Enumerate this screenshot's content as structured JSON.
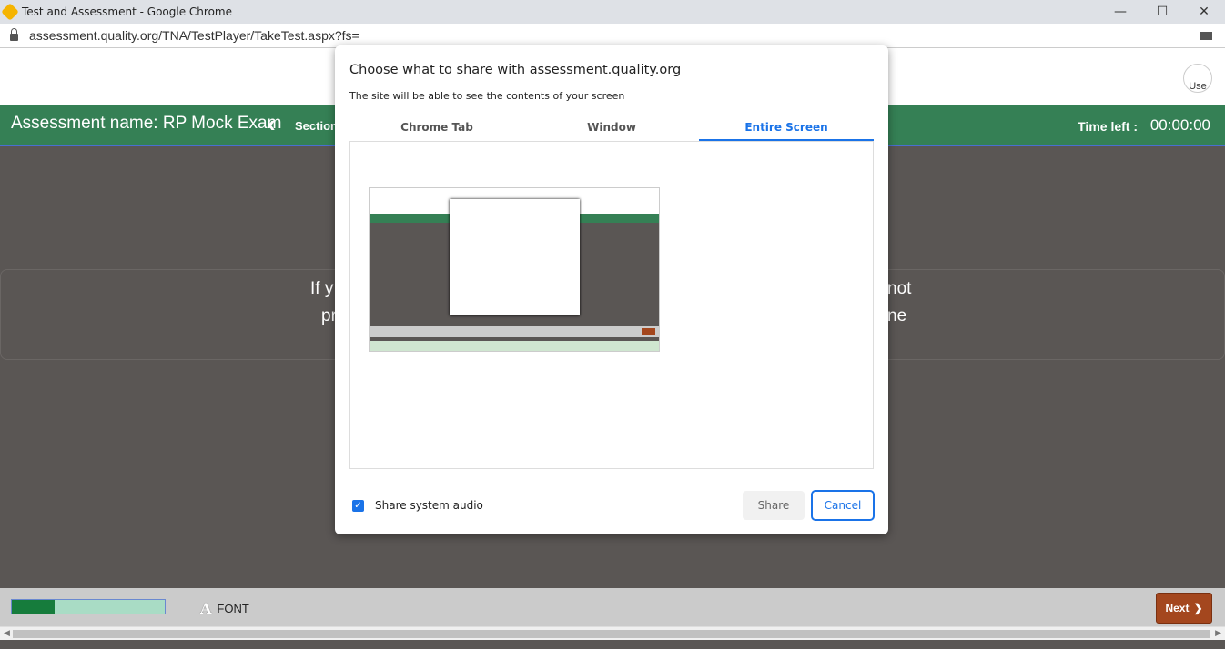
{
  "window": {
    "title": "Test and Assessment - Google Chrome",
    "minimize": "—",
    "maximize": "☐",
    "close": "✕"
  },
  "address_bar": {
    "url": "assessment.quality.org/TNA/TestPlayer/TakeTest.aspx?fs="
  },
  "header": {
    "avatar_alt": "Use",
    "assessment_name": "Assessment name: RP Mock Exam",
    "prev_icon": "‹",
    "section_label": "Section",
    "time_left_label": "Time left :",
    "time_left_value": "00:00:00"
  },
  "question": {
    "line1_left": "If y",
    "line1_right": "not",
    "line2_left": "pr",
    "line2_right": "ne"
  },
  "footer": {
    "progress_percent": 28,
    "font_icon": "A",
    "font_label": "FONT",
    "next_label": "Next",
    "next_icon": "❯"
  },
  "share_dialog": {
    "title": "Choose what to share with assessment.quality.org",
    "subtitle": "The site will be able to see the contents of your screen",
    "tabs": [
      {
        "label": "Chrome Tab",
        "active": false
      },
      {
        "label": "Window",
        "active": false
      },
      {
        "label": "Entire Screen",
        "active": true
      }
    ],
    "share_audio_label": "Share system audio",
    "share_audio_checked": true,
    "share_label": "Share",
    "cancel_label": "Cancel"
  },
  "colors": {
    "green": "#358055",
    "accent": "#1a73e8",
    "next": "#a4471e"
  }
}
